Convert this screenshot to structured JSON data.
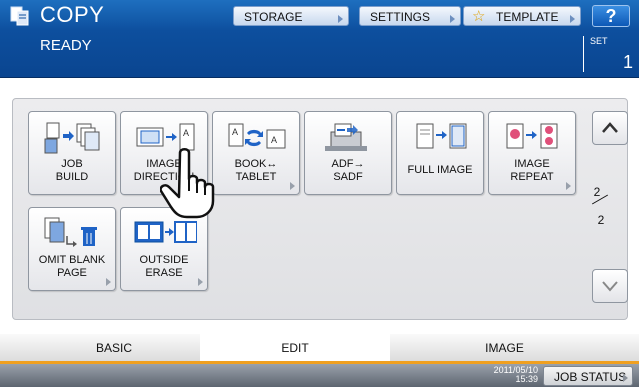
{
  "header": {
    "app_title": "COPY",
    "status": "READY",
    "set_label": "SET",
    "set_count": "1",
    "buttons": {
      "storage": "STORAGE",
      "settings": "SETTINGS",
      "template": "TEMPLATE",
      "help": "?"
    }
  },
  "functions": [
    {
      "label": "JOB\nBUILD",
      "icon": "job-build-icon"
    },
    {
      "label": "IMAGE\nDIRECTION",
      "icon": "image-direction-icon"
    },
    {
      "label": "BOOK↔\nTABLET",
      "icon": "book-tablet-icon"
    },
    {
      "label": "ADF→\nSADF",
      "icon": "adf-sadf-icon"
    },
    {
      "label": "FULL IMAGE",
      "icon": "full-image-icon"
    },
    {
      "label": "IMAGE\nREPEAT",
      "icon": "image-repeat-icon"
    },
    {
      "label": "OMIT BLANK\nPAGE",
      "icon": "omit-blank-page-icon"
    },
    {
      "label": "OUTSIDE\nERASE",
      "icon": "outside-erase-icon"
    }
  ],
  "pagination": {
    "current": "2",
    "total": "2"
  },
  "tabs": {
    "basic": "BASIC",
    "edit": "EDIT",
    "image": "IMAGE",
    "active": "EDIT"
  },
  "footer": {
    "date": "2011/05/10",
    "time": "15:39",
    "job_status": "JOB STATUS"
  },
  "colors": {
    "header": "#0d4f9e",
    "accent_tab": "#f0a020",
    "icon_blue": "#1f63c6",
    "icon_pink": "#e0507a"
  }
}
